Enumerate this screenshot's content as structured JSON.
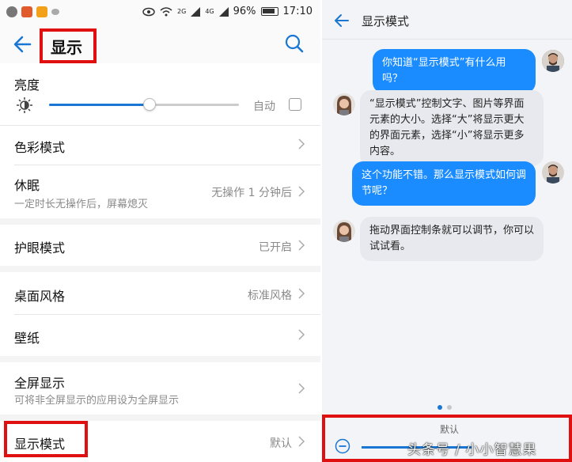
{
  "status_bar": {
    "network_2g": "2G",
    "network_4g": "4G",
    "battery": "96%",
    "time": "17:10"
  },
  "settings": {
    "title": "显示",
    "brightness": {
      "label": "亮度",
      "auto_label": "自动",
      "level": 0.53
    },
    "items": [
      {
        "label": "色彩模式",
        "value": "",
        "sub": ""
      },
      {
        "label": "休眠",
        "value": "无操作 1 分钟后",
        "sub": "一定时长无操作后，屏幕熄灭"
      },
      {
        "label": "护眼模式",
        "value": "已开启",
        "sub": ""
      },
      {
        "label": "桌面风格",
        "value": "标准风格",
        "sub": ""
      },
      {
        "label": "壁纸",
        "value": "",
        "sub": ""
      },
      {
        "label": "全屏显示",
        "value": "",
        "sub": "可将非全屏显示的应用设为全屏显示"
      },
      {
        "label": "显示模式",
        "value": "默认",
        "sub": ""
      }
    ]
  },
  "chat": {
    "title": "显示模式",
    "messages": [
      {
        "role": "user",
        "text": "你知道“显示模式”有什么用吗？"
      },
      {
        "role": "bot",
        "text": "“显示模式”控制文字、图片等界面元素的大小。选择“大”将显示更大的界面元素，选择“小”将显示更多内容。"
      },
      {
        "role": "user",
        "text": "这个功能不错。那么显示模式如何调节呢？"
      },
      {
        "role": "bot",
        "text": "拖动界面控制条就可以调节，你可以试试看。"
      }
    ],
    "mode_label": "默认",
    "watermark": "头条号 / 小小智慧果"
  },
  "colors": {
    "accent": "#1976d2",
    "highlight": "#e01010",
    "bubble_user": "#1a8cff"
  }
}
